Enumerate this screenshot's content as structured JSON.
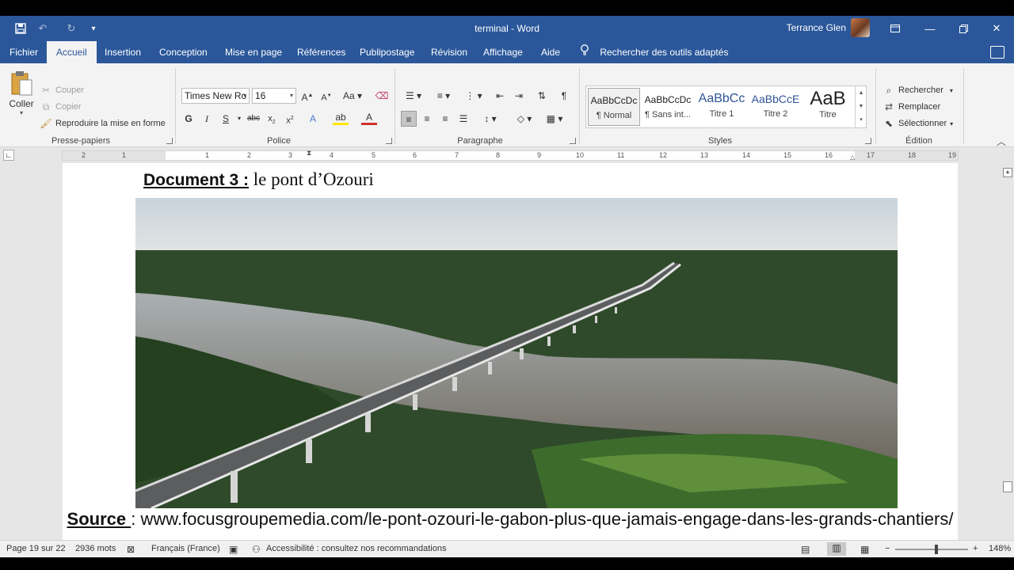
{
  "titlebar": {
    "document_name": "terminal",
    "separator": "-",
    "app_name": "Word",
    "user_name": "Terrance Glen"
  },
  "menu": {
    "tabs": [
      "Fichier",
      "Accueil",
      "Insertion",
      "Conception",
      "Mise en page",
      "Références",
      "Publipostage",
      "Révision",
      "Affichage",
      "Aide"
    ],
    "active_tab": "Accueil",
    "tell_me": "Rechercher des outils adaptés"
  },
  "ribbon": {
    "clipboard": {
      "paste": "Coller",
      "cut": "Couper",
      "copy": "Copier",
      "format_painter": "Reproduire la mise en forme",
      "label": "Presse-papiers"
    },
    "font": {
      "family": "Times New Ro",
      "size": "16",
      "label": "Police"
    },
    "paragraph": {
      "label": "Paragraphe"
    },
    "styles": {
      "label": "Styles",
      "items": [
        {
          "sample": "AaBbCcDc",
          "name": "¶ Normal"
        },
        {
          "sample": "AaBbCcDc",
          "name": "¶ Sans int..."
        },
        {
          "sample": "AaBbCc",
          "name": "Titre 1"
        },
        {
          "sample": "AaBbCcE",
          "name": "Titre 2"
        },
        {
          "sample": "AaB",
          "name": "Titre"
        }
      ]
    },
    "editing": {
      "find": "Rechercher",
      "replace": "Remplacer",
      "select": "Sélectionner",
      "label": "Édition"
    }
  },
  "ruler": {
    "left_numbers": [
      "2",
      "1"
    ],
    "right_numbers": [
      "1",
      "2",
      "3",
      "4",
      "5",
      "6",
      "7",
      "8",
      "9",
      "10",
      "11",
      "12",
      "13",
      "14",
      "15",
      "16",
      "17",
      "18",
      "19"
    ]
  },
  "document": {
    "heading_label": "Document 3 :",
    "heading_text": " le pont d’Ozouri",
    "source_label": "Source ",
    "source_text": ": www.focusgroupemedia.com/le-pont-ozouri-le-gabon-plus-que-jamais-engage-dans-les-grands-chantiers/"
  },
  "status": {
    "page": "Page 19 sur 22",
    "words": "2936 mots",
    "language": "Français (France)",
    "accessibility": "Accessibilité : consultez nos recommandations",
    "zoom": "148%"
  },
  "colors": {
    "brand": "#2b579a",
    "ribbon_bg": "#f3f3f3"
  }
}
